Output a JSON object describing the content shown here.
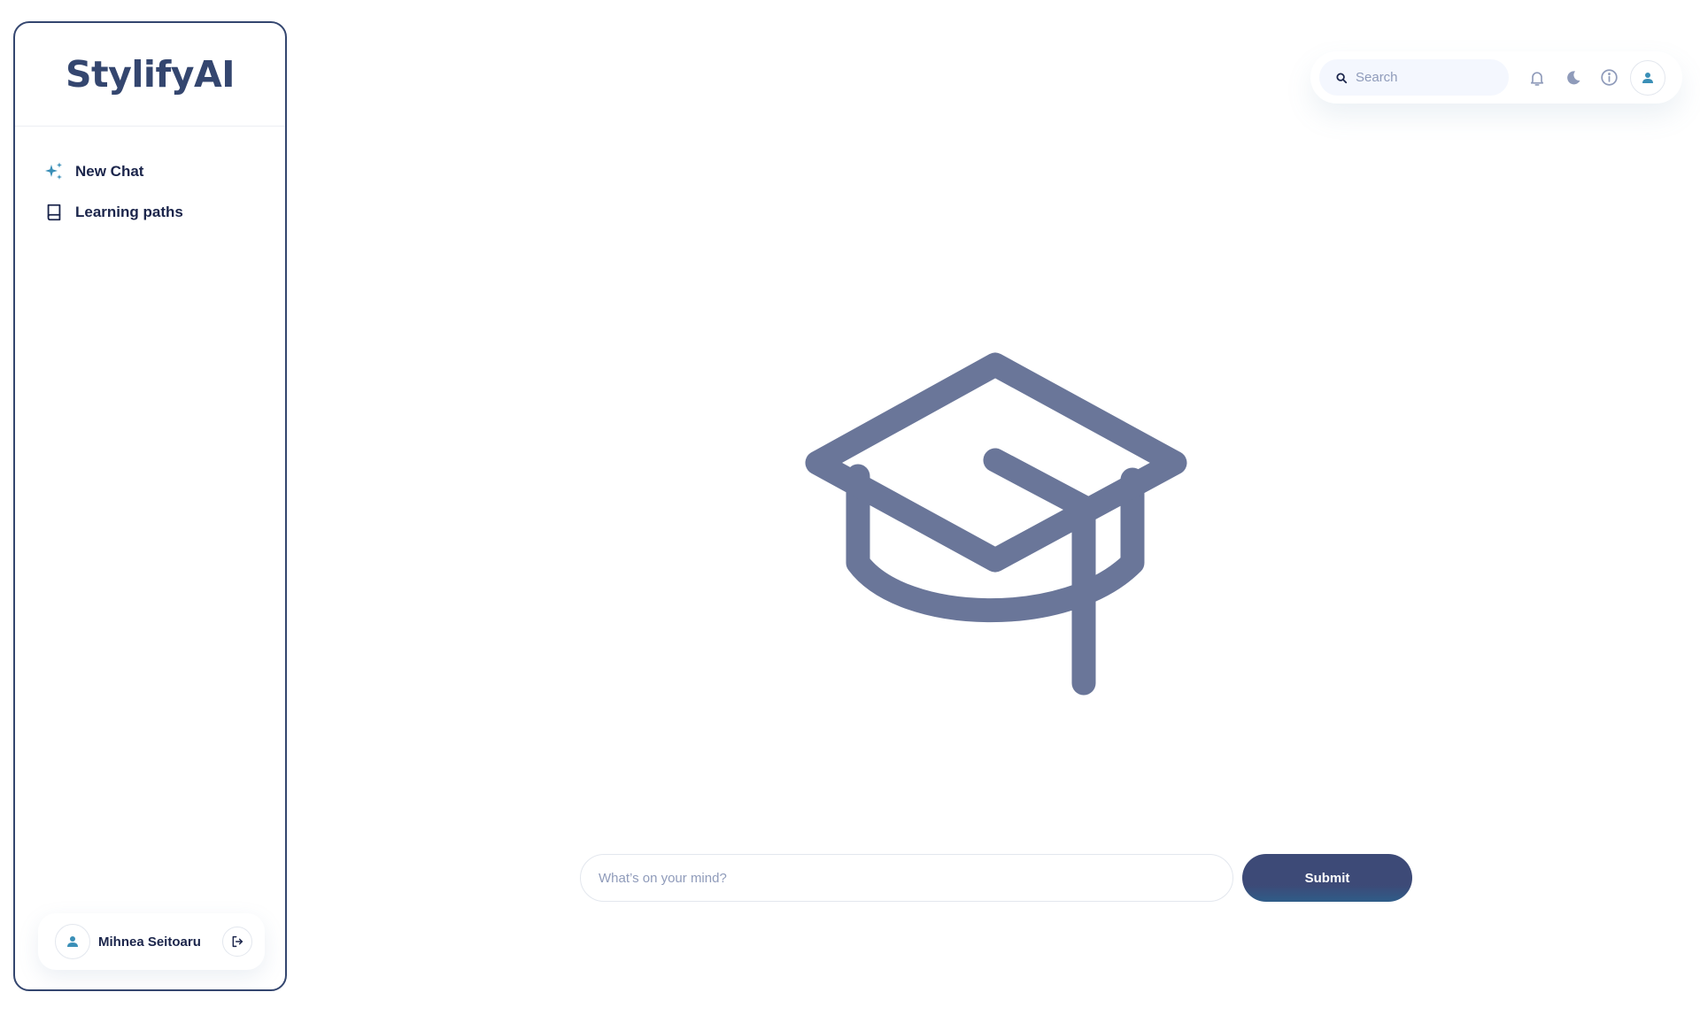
{
  "brand": {
    "name": "StylifyAI"
  },
  "sidebar": {
    "items": [
      {
        "label": "New Chat",
        "icon": "sparkles-icon"
      },
      {
        "label": "Learning paths",
        "icon": "book-icon"
      }
    ]
  },
  "user": {
    "name": "Mihnea Seitoaru",
    "icon": "person-icon",
    "logout_icon": "logout-icon"
  },
  "header": {
    "search_placeholder": "Search",
    "icons": [
      "bell-icon",
      "moon-icon",
      "info-icon",
      "person-icon"
    ]
  },
  "composer": {
    "placeholder": "What’s on your mind?",
    "submit_label": "Submit"
  },
  "colors": {
    "primary": "#34466f",
    "accent": "#3a8fb7",
    "hero": "#6a7699",
    "text": "#1b254b",
    "muted": "#8f9bba"
  }
}
